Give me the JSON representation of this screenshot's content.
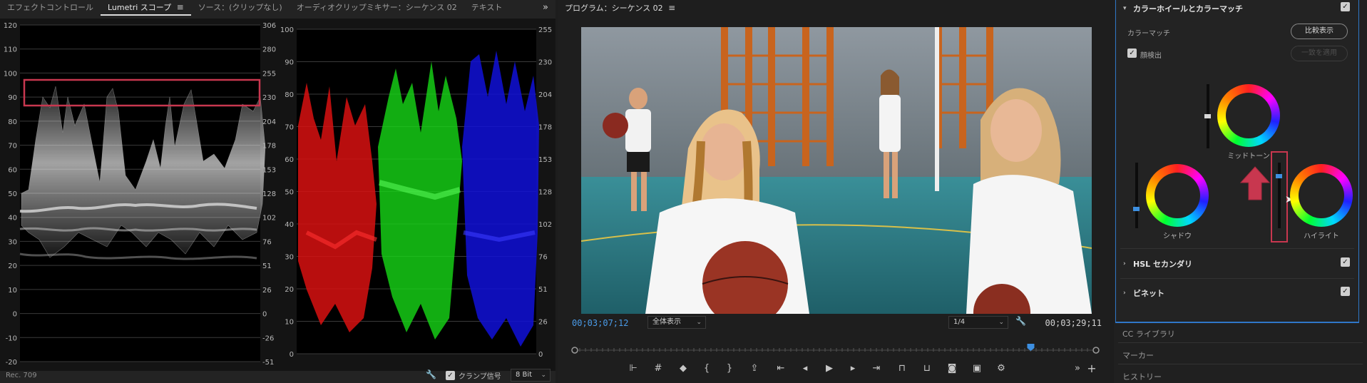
{
  "left_panel": {
    "tabs": [
      {
        "label": "エフェクトコントロール"
      },
      {
        "label": "Lumetri スコープ",
        "active": true
      },
      {
        "label": "ソース：(クリップなし)"
      },
      {
        "label": "オーディオクリップミキサー：シーケンス 02"
      },
      {
        "label": "テキスト"
      }
    ],
    "overflow_glyph": "»",
    "waveform": {
      "ticks_left": [
        "120",
        "110",
        "100",
        "90",
        "80",
        "70",
        "60",
        "50",
        "40",
        "30",
        "20",
        "10",
        "0",
        "-10",
        "-20"
      ],
      "ticks_right": [
        "306",
        "280",
        "255",
        "230",
        "204",
        "178",
        "153",
        "128",
        "102",
        "76",
        "51",
        "26",
        "0",
        "-26",
        "-51"
      ]
    },
    "parade": {
      "ticks_left": [
        "100",
        "90",
        "80",
        "70",
        "60",
        "50",
        "40",
        "30",
        "20",
        "10",
        "0"
      ],
      "ticks_right": [
        "255",
        "230",
        "204",
        "178",
        "153",
        "128",
        "102",
        "76",
        "51",
        "26",
        "0"
      ]
    },
    "footer": {
      "standard": "Rec. 709",
      "clamp_label": "クランプ信号",
      "bit_depth": "8 Bit"
    }
  },
  "program_monitor": {
    "title": "プログラム：シーケンス 02",
    "current_timecode": "00;03;07;12",
    "duration_timecode": "00;03;29;11",
    "zoom": "全体表示",
    "resolution": "1/4",
    "playhead_fraction": 0.88
  },
  "lumetri_color": {
    "section_title": "カラーホイールとカラーマッチ",
    "color_match_label": "カラーマッチ",
    "compare_button": "比較表示",
    "face_detect_label": "顔検出",
    "apply_match_button": "一致を適用",
    "wheels": [
      {
        "label": "ミッドトーン"
      },
      {
        "label": "シャドウ"
      },
      {
        "label": "ハイライト"
      }
    ],
    "sections": [
      {
        "label": "HSL セカンダリ"
      },
      {
        "label": "ビネット"
      }
    ]
  },
  "lower_panels": [
    {
      "label": "CC ライブラリ"
    },
    {
      "label": "マーカー"
    },
    {
      "label": "ヒストリー"
    }
  ],
  "colors": {
    "accent_blue": "#2f77c8",
    "timecode_blue": "#4a9be8",
    "highlight_red": "#c8374f"
  }
}
